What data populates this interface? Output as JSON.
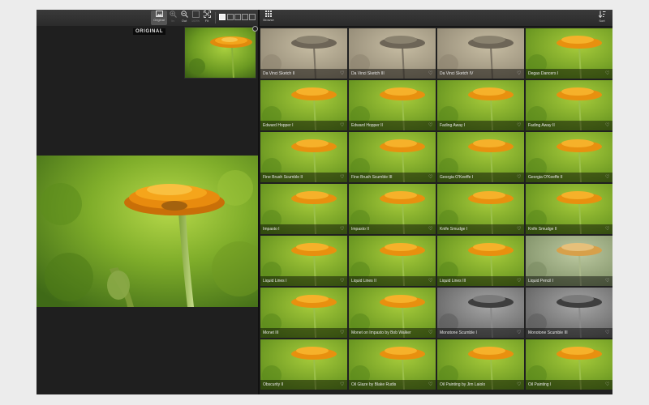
{
  "toolbar": {
    "original_label": "Original",
    "zoom_in_label": "In",
    "zoom_out_label": "Out",
    "zoom_100_label": "100%",
    "fit_label": "Fit",
    "browse_label": "Browse",
    "sort_label": "Sort"
  },
  "preview": {
    "original_badge": "ORIGINAL"
  },
  "colors": {
    "tile_color": "#8fb02a",
    "tile_warm": "#a7b13f",
    "sketch": "#b9ad8e",
    "mono": "#8f8f8f"
  },
  "tiles": [
    {
      "name": "Da Vinci Sketch II",
      "style": "sketch"
    },
    {
      "name": "Da Vinci Sketch III",
      "style": "sketch"
    },
    {
      "name": "Da Vinci Sketch IV",
      "style": "sketch"
    },
    {
      "name": "Degas Dancers I",
      "style": "color"
    },
    {
      "name": "Edward Hopper I",
      "style": "color"
    },
    {
      "name": "Edward Hopper II",
      "style": "color"
    },
    {
      "name": "Fading Away I",
      "style": "color"
    },
    {
      "name": "Fading Away II",
      "style": "color"
    },
    {
      "name": "Fine Brush Scumble II",
      "style": "color"
    },
    {
      "name": "Fine Brush Scumble III",
      "style": "color"
    },
    {
      "name": "Georgia O'Keeffe I",
      "style": "color"
    },
    {
      "name": "Georgia O'Keeffe II",
      "style": "color"
    },
    {
      "name": "Impasto I",
      "style": "color"
    },
    {
      "name": "Impasto II",
      "style": "color"
    },
    {
      "name": "Knife Smudge I",
      "style": "color"
    },
    {
      "name": "Knife Smudge II",
      "style": "color"
    },
    {
      "name": "Liquid Lines I",
      "style": "color"
    },
    {
      "name": "Liquid Lines II",
      "style": "color"
    },
    {
      "name": "Liquid Lines III",
      "style": "color"
    },
    {
      "name": "Liquid Pencil I",
      "style": "pale"
    },
    {
      "name": "Monet III",
      "style": "color"
    },
    {
      "name": "Monet on Impasto by Bob Walker",
      "style": "color"
    },
    {
      "name": "Monotone Scumble I",
      "style": "mono"
    },
    {
      "name": "Monotone Scumble III",
      "style": "mono"
    },
    {
      "name": "Obscurity II",
      "style": "color"
    },
    {
      "name": "Oil Glaze by Blake Rudis",
      "style": "color"
    },
    {
      "name": "Oil Painting by Jim Laiolo",
      "style": "color"
    },
    {
      "name": "Oil Painting I",
      "style": "color"
    }
  ]
}
